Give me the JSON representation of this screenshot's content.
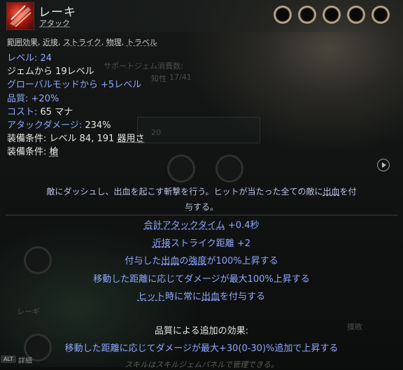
{
  "skill": {
    "name": "レーキ",
    "tag": "アタック",
    "sockets": 5
  },
  "tags": [
    "範囲効果",
    "近接",
    "ストライク",
    "物理",
    "トラベル"
  ],
  "stats": {
    "level_label": "レベル:",
    "level_value": "24",
    "gem_level": "ジェムから 19レベル",
    "global_mod": "グローバルモッドから +5レベル",
    "quality_label": "品質:",
    "quality_value": "+20%",
    "cost_label": "コスト:",
    "cost_value": "65 マナ",
    "attack_damage_label": "アタックダメージ:",
    "attack_damage_value": "234%",
    "req1_label": "装備条件:",
    "req1_value": "レベル 84, 191",
    "req1_attr": "器用さ",
    "req2_label": "装備条件:",
    "req2_value": "槍"
  },
  "description": {
    "line1_a": "敵にダッシュし、出血を起こす斬撃を行う。ヒットが当たった全ての敵に",
    "line1_u": "出血",
    "line1_b": "を付",
    "line2": "与する。"
  },
  "mods": [
    {
      "u": "合計アタックタイム",
      "rest": " +0.4秒"
    },
    {
      "u": "近接",
      "rest": "ストライク距離 +2"
    },
    {
      "pre": "付与した",
      "u": "出血",
      "mid": "の",
      "u2": "強度",
      "rest": "が100%上昇する"
    },
    {
      "pre": "移動した距離に応じてダメージが最大100%上昇する"
    },
    {
      "u": "ヒット",
      "mid": "時に常に",
      "u2": "出血",
      "rest": "を付与する"
    }
  ],
  "quality": {
    "title": "品質による追加の効果:",
    "mod": "移動した距離に応じてダメージが最大+30(0-30)%追加で上昇する"
  },
  "footer": {
    "alt_key": "ALT",
    "alt_label": "詳細",
    "note": "スキルはスキルジェムパネルで管理できる。"
  },
  "background_ghost": {
    "support_label": "サポートジェム消費数:",
    "stat_label": "知性",
    "stat_value": "17/41",
    "number": "20",
    "corner_label": "レーギ",
    "right_label": "撲敗"
  },
  "colors": {
    "accent_blue": "#8fa8ff",
    "text_white": "#e8e8e8",
    "description": "#b9c4e0",
    "socket_gold": "#c6b896"
  }
}
